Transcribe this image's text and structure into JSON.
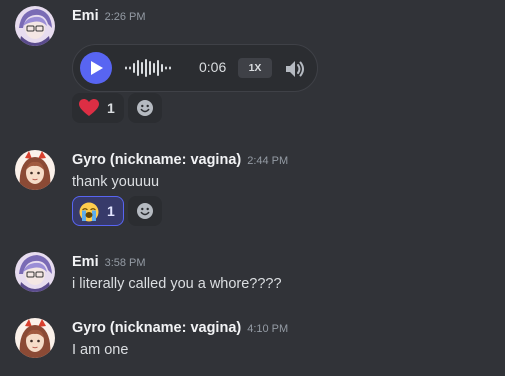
{
  "messages": [
    {
      "username": "Emi",
      "timestamp": "2:26 PM",
      "avatar": "emi-avatar",
      "voice": {
        "duration": "0:06",
        "speed": "1X",
        "play_icon": "play-icon",
        "volume_icon": "volume-icon"
      },
      "reactions": [
        {
          "emoji": "red-heart",
          "count": "1",
          "active": false
        }
      ]
    },
    {
      "username": "Gyro (nickname: vagina)",
      "timestamp": "2:44 PM",
      "avatar": "gyro-avatar",
      "text": "thank youuuu",
      "reactions": [
        {
          "emoji": "loudly-crying-face",
          "count": "1",
          "active": true
        }
      ]
    },
    {
      "username": "Emi",
      "timestamp": "3:58 PM",
      "avatar": "emi-avatar",
      "text": "i literally called you a whore????"
    },
    {
      "username": "Gyro (nickname: vagina)",
      "timestamp": "4:10 PM",
      "avatar": "gyro-avatar",
      "text": "I am one"
    }
  ],
  "colors": {
    "background": "#313338",
    "accent": "#5865f2",
    "username": "#f2f3f5",
    "timestamp": "#949ba4"
  }
}
